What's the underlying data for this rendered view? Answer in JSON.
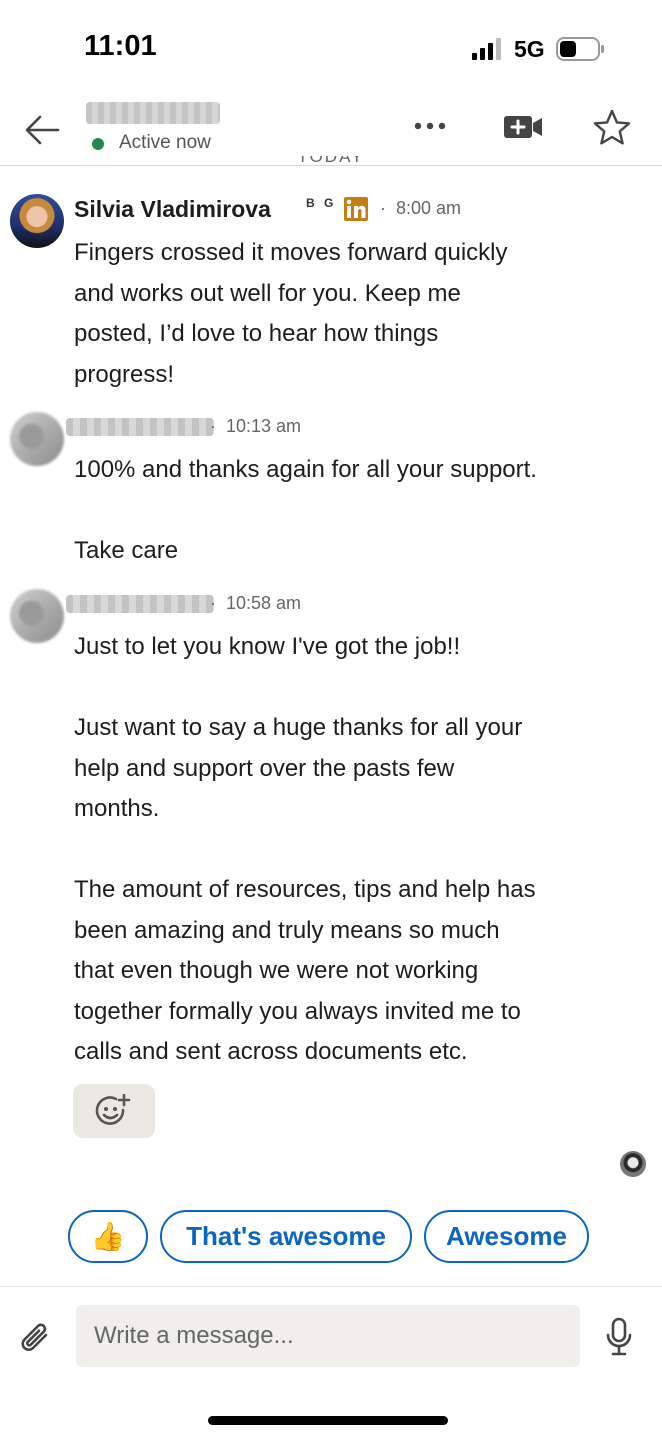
{
  "status_bar": {
    "time": "11:01",
    "network": "5G"
  },
  "header": {
    "presence": "Active now"
  },
  "day_divider": "TODAY",
  "messages": [
    {
      "sender": "Silvia Vladimirova",
      "badge": "B G",
      "time": "8:00 am",
      "text": "Fingers crossed it moves forward quickly\nand works out well for you. Keep me\nposted, I’d love to hear how things\nprogress!"
    },
    {
      "time": "10:13 am",
      "text": "100% and thanks again for all your support.\n\nTake care"
    },
    {
      "time": "10:58 am",
      "text": "Just to let you know I've got the job!!\n\nJust want to say a huge thanks for all your\nhelp and support over the pasts few\nmonths.\n\nThe amount of resources, tips and help has\nbeen amazing and truly means so much\nthat even though we were not working\ntogether formally you always invited me to\ncalls and sent across documents etc."
    }
  ],
  "quick_replies": [
    "👍",
    "That's awesome",
    "Awesome"
  ],
  "composer": {
    "placeholder": "Write a message..."
  },
  "colors": {
    "accent": "#0a66c2",
    "presence": "#1f8a4c",
    "linkedin_badge": "#c37d16"
  },
  "icons": [
    "back-arrow-icon",
    "more-icon",
    "video-call-icon",
    "star-icon",
    "linkedin-icon",
    "add-reaction-icon",
    "attach-icon",
    "mic-icon",
    "signal-icon",
    "battery-icon"
  ]
}
